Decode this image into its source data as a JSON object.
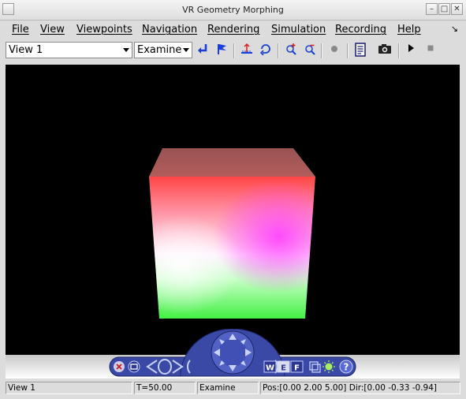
{
  "window": {
    "title": "VR Geometry Morphing"
  },
  "menu": [
    "File",
    "View",
    "Viewpoints",
    "Navigation",
    "Rendering",
    "Simulation",
    "Recording",
    "Help"
  ],
  "toolbar": {
    "viewpoint": "View 1",
    "mode": "Examine",
    "icons": [
      "return-icon",
      "flag-icon",
      "straighten-icon",
      "restore-icon",
      "zoom-in-icon",
      "zoom-out-icon",
      "record-dot-icon",
      "document-icon",
      "camera-icon",
      "play-icon",
      "stop-icon"
    ]
  },
  "nav": {
    "w_label": "W",
    "e_label": "E",
    "f_label": "F",
    "help_label": "?"
  },
  "colors": {
    "cube_red": "#ff4a4a",
    "cube_green": "#4cfc4c",
    "cube_magenta": "#ff55ff",
    "nav_blue": "#3b49a6"
  },
  "status": {
    "viewpoint": "View 1",
    "time": "T=50.00",
    "mode": "Examine",
    "pos_dir": "Pos:[0.00 2.00 5.00] Dir:[0.00 -0.33 -0.94]"
  }
}
